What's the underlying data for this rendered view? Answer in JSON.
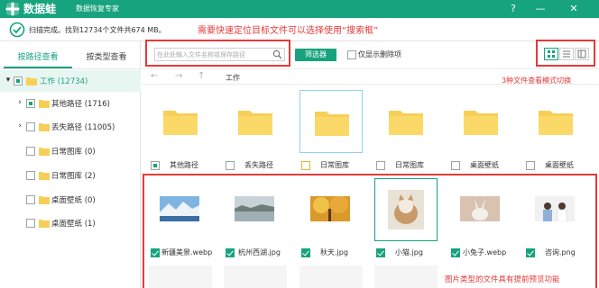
{
  "app": {
    "name": "数据蛙",
    "subtitle": "数据恢复专家",
    "window_buttons": {
      "help": "?",
      "minimize": "—",
      "close": "✕"
    }
  },
  "status": {
    "text": "扫描完成。找到12734个文件共674 MB。",
    "hint": "需要快速定位目标文件可以选择使用“搜索框”"
  },
  "left": {
    "tabs": {
      "by_path": "按路径查看",
      "by_type": "按类型查看"
    },
    "tree": [
      {
        "label": "工作 (12734)",
        "selected": true
      },
      {
        "label": "其他路径 (1716)"
      },
      {
        "label": "丢失路径 (11005)"
      },
      {
        "label": "日常图库 (0)"
      },
      {
        "label": "日常图库 (2)"
      },
      {
        "label": "桌面壁纸 (0)"
      },
      {
        "label": "桌面壁纸 (1)"
      }
    ]
  },
  "toolbar": {
    "search_placeholder": "在此处输入文件名称或保存路径",
    "filter_label": "筛选器",
    "show_deleted_label": "仅显示删除项",
    "view_hint": "3种文件查看模式切换"
  },
  "nav": {
    "back": "←",
    "forward": "→",
    "up": "↑",
    "crumb": "工作"
  },
  "folders": [
    {
      "label": "其他路径",
      "state": "partial"
    },
    {
      "label": "丢失路径",
      "state": "empty"
    },
    {
      "label": "日常图库",
      "state": "empty",
      "highlighted": true
    },
    {
      "label": "日常图库",
      "state": "empty"
    },
    {
      "label": "桌面壁纸",
      "state": "empty"
    },
    {
      "label": "桌面壁纸",
      "state": "empty"
    }
  ],
  "images": [
    {
      "label": "新疆美景.webp",
      "checked": true
    },
    {
      "label": "杭州西湖.jpg",
      "checked": true
    },
    {
      "label": "秋天.jpg",
      "checked": true
    },
    {
      "label": "小猫.jpg",
      "checked": true,
      "highlighted": true
    },
    {
      "label": "小兔子.webp",
      "checked": true
    },
    {
      "label": "咨询.png",
      "checked": true
    }
  ],
  "preview_hint": "图片类型的文件具有提前预览功能",
  "colors": {
    "brand": "#17a37e",
    "annotation": "#e23b3b",
    "folder": "#f7cf57"
  }
}
